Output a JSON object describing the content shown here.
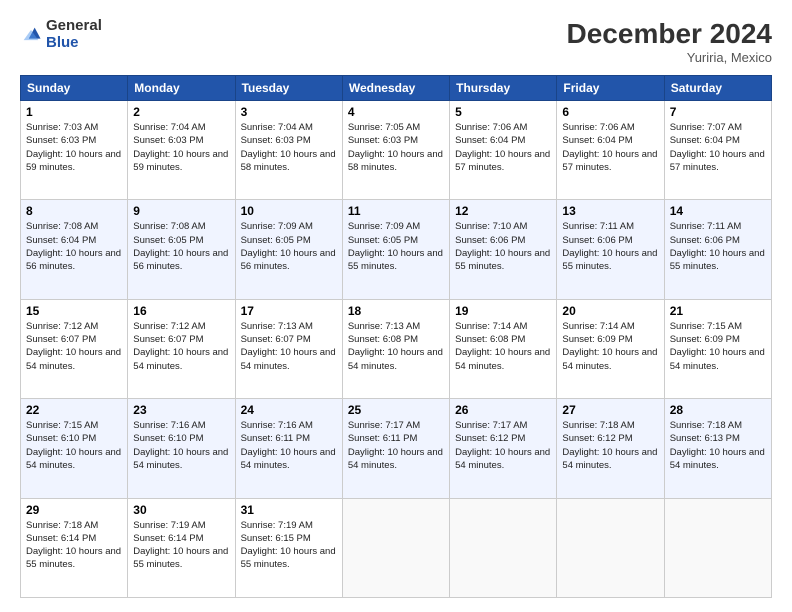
{
  "logo": {
    "general": "General",
    "blue": "Blue"
  },
  "title": "December 2024",
  "location": "Yuriria, Mexico",
  "days_of_week": [
    "Sunday",
    "Monday",
    "Tuesday",
    "Wednesday",
    "Thursday",
    "Friday",
    "Saturday"
  ],
  "weeks": [
    [
      {
        "day": 1,
        "sunrise": "7:03 AM",
        "sunset": "6:03 PM",
        "daylight": "10 hours and 59 minutes."
      },
      {
        "day": 2,
        "sunrise": "7:04 AM",
        "sunset": "6:03 PM",
        "daylight": "10 hours and 59 minutes."
      },
      {
        "day": 3,
        "sunrise": "7:04 AM",
        "sunset": "6:03 PM",
        "daylight": "10 hours and 58 minutes."
      },
      {
        "day": 4,
        "sunrise": "7:05 AM",
        "sunset": "6:03 PM",
        "daylight": "10 hours and 58 minutes."
      },
      {
        "day": 5,
        "sunrise": "7:06 AM",
        "sunset": "6:04 PM",
        "daylight": "10 hours and 57 minutes."
      },
      {
        "day": 6,
        "sunrise": "7:06 AM",
        "sunset": "6:04 PM",
        "daylight": "10 hours and 57 minutes."
      },
      {
        "day": 7,
        "sunrise": "7:07 AM",
        "sunset": "6:04 PM",
        "daylight": "10 hours and 57 minutes."
      }
    ],
    [
      {
        "day": 8,
        "sunrise": "7:08 AM",
        "sunset": "6:04 PM",
        "daylight": "10 hours and 56 minutes."
      },
      {
        "day": 9,
        "sunrise": "7:08 AM",
        "sunset": "6:05 PM",
        "daylight": "10 hours and 56 minutes."
      },
      {
        "day": 10,
        "sunrise": "7:09 AM",
        "sunset": "6:05 PM",
        "daylight": "10 hours and 56 minutes."
      },
      {
        "day": 11,
        "sunrise": "7:09 AM",
        "sunset": "6:05 PM",
        "daylight": "10 hours and 55 minutes."
      },
      {
        "day": 12,
        "sunrise": "7:10 AM",
        "sunset": "6:06 PM",
        "daylight": "10 hours and 55 minutes."
      },
      {
        "day": 13,
        "sunrise": "7:11 AM",
        "sunset": "6:06 PM",
        "daylight": "10 hours and 55 minutes."
      },
      {
        "day": 14,
        "sunrise": "7:11 AM",
        "sunset": "6:06 PM",
        "daylight": "10 hours and 55 minutes."
      }
    ],
    [
      {
        "day": 15,
        "sunrise": "7:12 AM",
        "sunset": "6:07 PM",
        "daylight": "10 hours and 54 minutes."
      },
      {
        "day": 16,
        "sunrise": "7:12 AM",
        "sunset": "6:07 PM",
        "daylight": "10 hours and 54 minutes."
      },
      {
        "day": 17,
        "sunrise": "7:13 AM",
        "sunset": "6:07 PM",
        "daylight": "10 hours and 54 minutes."
      },
      {
        "day": 18,
        "sunrise": "7:13 AM",
        "sunset": "6:08 PM",
        "daylight": "10 hours and 54 minutes."
      },
      {
        "day": 19,
        "sunrise": "7:14 AM",
        "sunset": "6:08 PM",
        "daylight": "10 hours and 54 minutes."
      },
      {
        "day": 20,
        "sunrise": "7:14 AM",
        "sunset": "6:09 PM",
        "daylight": "10 hours and 54 minutes."
      },
      {
        "day": 21,
        "sunrise": "7:15 AM",
        "sunset": "6:09 PM",
        "daylight": "10 hours and 54 minutes."
      }
    ],
    [
      {
        "day": 22,
        "sunrise": "7:15 AM",
        "sunset": "6:10 PM",
        "daylight": "10 hours and 54 minutes."
      },
      {
        "day": 23,
        "sunrise": "7:16 AM",
        "sunset": "6:10 PM",
        "daylight": "10 hours and 54 minutes."
      },
      {
        "day": 24,
        "sunrise": "7:16 AM",
        "sunset": "6:11 PM",
        "daylight": "10 hours and 54 minutes."
      },
      {
        "day": 25,
        "sunrise": "7:17 AM",
        "sunset": "6:11 PM",
        "daylight": "10 hours and 54 minutes."
      },
      {
        "day": 26,
        "sunrise": "7:17 AM",
        "sunset": "6:12 PM",
        "daylight": "10 hours and 54 minutes."
      },
      {
        "day": 27,
        "sunrise": "7:18 AM",
        "sunset": "6:12 PM",
        "daylight": "10 hours and 54 minutes."
      },
      {
        "day": 28,
        "sunrise": "7:18 AM",
        "sunset": "6:13 PM",
        "daylight": "10 hours and 54 minutes."
      }
    ],
    [
      {
        "day": 29,
        "sunrise": "7:18 AM",
        "sunset": "6:14 PM",
        "daylight": "10 hours and 55 minutes."
      },
      {
        "day": 30,
        "sunrise": "7:19 AM",
        "sunset": "6:14 PM",
        "daylight": "10 hours and 55 minutes."
      },
      {
        "day": 31,
        "sunrise": "7:19 AM",
        "sunset": "6:15 PM",
        "daylight": "10 hours and 55 minutes."
      },
      null,
      null,
      null,
      null
    ]
  ]
}
